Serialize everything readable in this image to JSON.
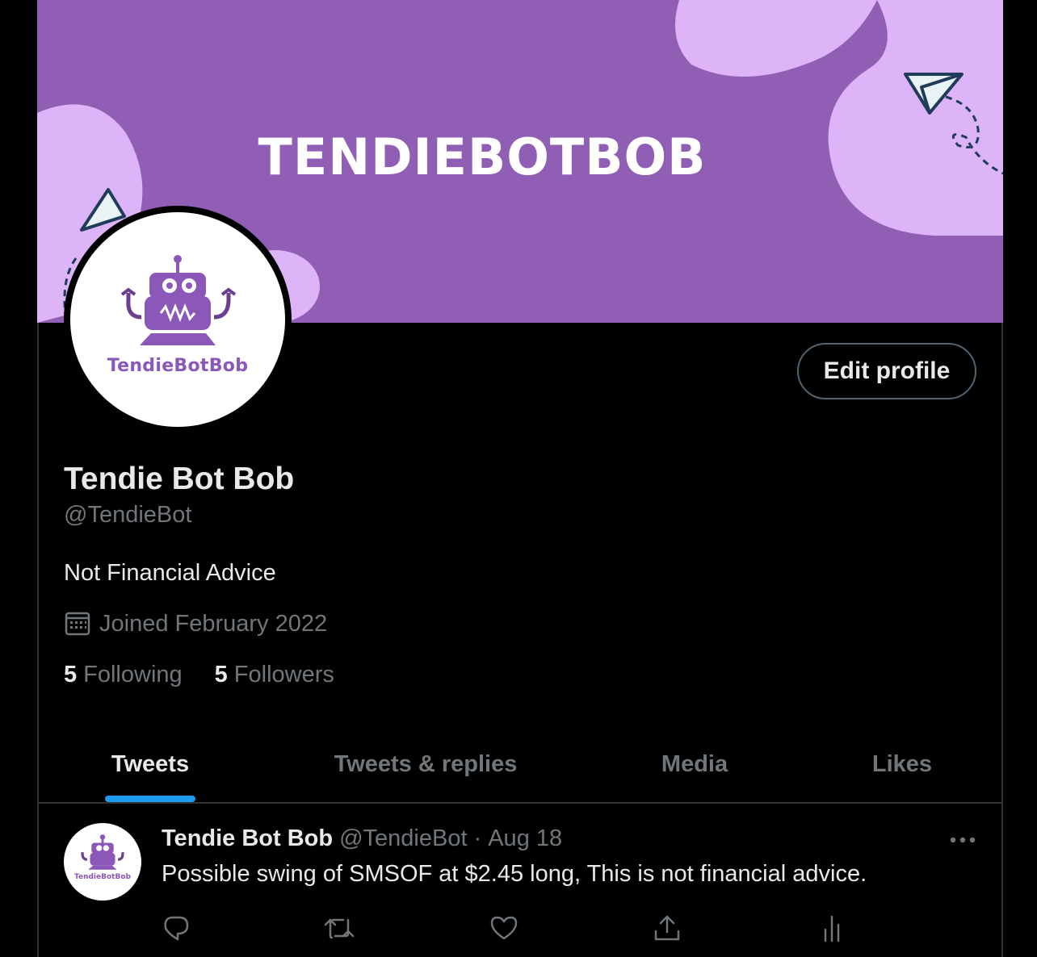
{
  "banner": {
    "title": "TENDIEBOTBOB",
    "colors": {
      "purple": "#905fb5",
      "blob": "#dcb4f7",
      "ink": "#1f3c58"
    }
  },
  "profile": {
    "avatar_brand": "TendieBotBob",
    "edit_label": "Edit profile",
    "display_name": "Tendie Bot Bob",
    "handle": "@TendieBot",
    "bio": "Not Financial Advice",
    "joined_icon": "calendar-icon",
    "joined": "Joined February 2022",
    "following_count": "5",
    "following_label": "Following",
    "followers_count": "5",
    "followers_label": "Followers"
  },
  "tabs": [
    {
      "label": "Tweets",
      "active": true
    },
    {
      "label": "Tweets & replies",
      "active": false
    },
    {
      "label": "Media",
      "active": false
    },
    {
      "label": "Likes",
      "active": false
    }
  ],
  "accent": "#1d9bf0",
  "tweet": {
    "avatar_brand": "TendieBotBob",
    "name": "Tendie Bot Bob",
    "handle": "@TendieBot",
    "separator": "·",
    "date": "Aug 18",
    "text": "Possible swing of SMSOF at $2.45 long, This is not financial advice.",
    "actions": [
      "reply-icon",
      "retweet-icon",
      "like-icon",
      "share-icon",
      "analytics-icon"
    ]
  }
}
